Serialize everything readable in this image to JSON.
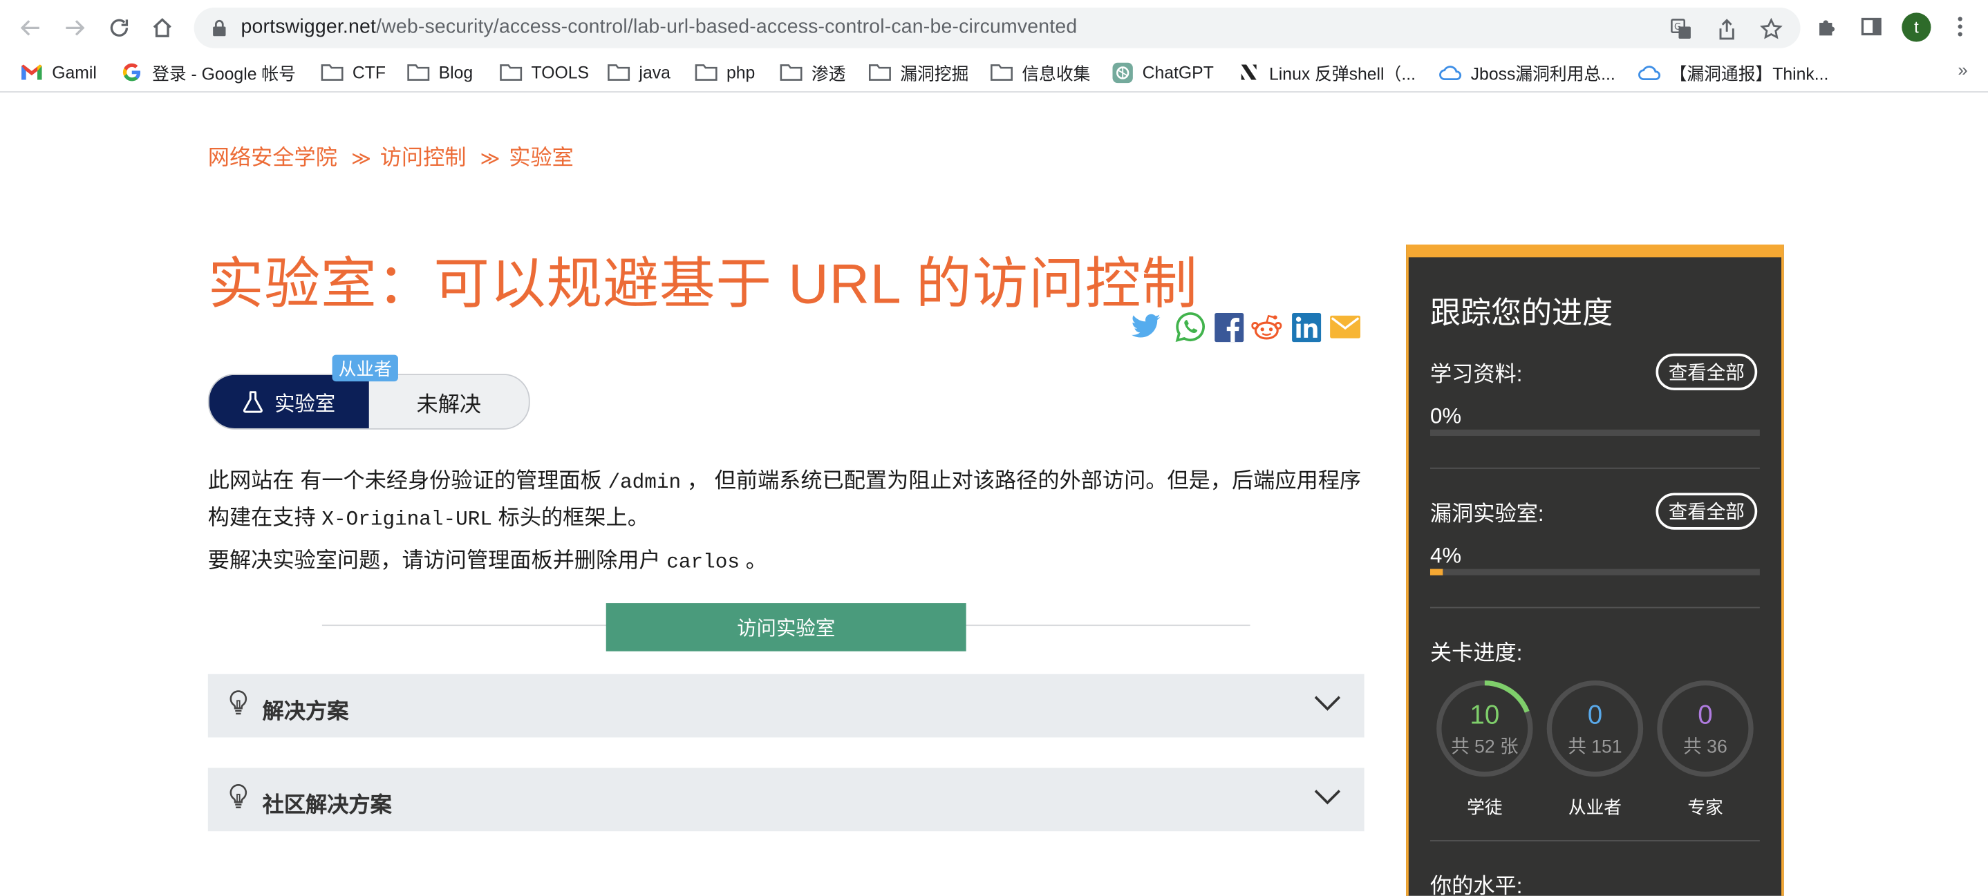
{
  "browser": {
    "url_host": "portswigger.net",
    "url_path": "/web-security/access-control/lab-url-based-access-control-can-be-circumvented",
    "profile_initial": "t",
    "bookmarks": [
      {
        "label": "Gamil",
        "icon": "gmail-icon"
      },
      {
        "label": "登录 - Google 帐号",
        "icon": "google-icon"
      },
      {
        "label": "CTF",
        "icon": "folder-icon"
      },
      {
        "label": "Blog",
        "icon": "folder-icon"
      },
      {
        "label": "TOOLS",
        "icon": "folder-icon"
      },
      {
        "label": "java",
        "icon": "folder-icon"
      },
      {
        "label": "php",
        "icon": "folder-icon"
      },
      {
        "label": "渗透",
        "icon": "folder-icon"
      },
      {
        "label": "漏洞挖掘",
        "icon": "folder-icon"
      },
      {
        "label": "信息收集",
        "icon": "folder-icon"
      },
      {
        "label": "ChatGPT",
        "icon": "chatgpt-icon"
      },
      {
        "label": "Linux 反弹shell（...",
        "icon": "notion-icon"
      },
      {
        "label": "Jboss漏洞利用总...",
        "icon": "cloud-icon"
      },
      {
        "label": "【漏洞通报】Think...",
        "icon": "cloud-icon"
      }
    ],
    "more_bookmarks": "»"
  },
  "breadcrumb": {
    "items": [
      "网络安全学院",
      "访问控制",
      "实验室"
    ],
    "separator": "≫"
  },
  "page": {
    "title": "实验室：可以规避基于 URL 的访问控制",
    "level_badge": "从业者",
    "lab_label": "实验室",
    "status": "未解决",
    "desc_part1": "此网站在 有一个未经身份验证的管理面板",
    "desc_code1": "/admin",
    "desc_part2": "， 但前端系统已配置为阻止对该路径的外部访问。但是，后端应用程序构建在支持",
    "desc_code2": "X-Original-URL",
    "desc_part3": "标头的框架上。",
    "task_part1": "要解决实验室问题，请访问管理面板并删除用户",
    "task_code": "carlos",
    "task_part2": "。",
    "access_button": "访问实验室",
    "solution_label": "解决方案",
    "community_label": "社区解决方案"
  },
  "sidebar": {
    "title": "跟踪您的进度",
    "learning_label": "学习资料:",
    "learning_pct": "0%",
    "learning_progress": 0,
    "labs_label": "漏洞实验室:",
    "labs_pct": "4%",
    "labs_progress": 0.04,
    "view_all": "查看全部",
    "levels_label": "关卡进度:",
    "rings": [
      {
        "count": "10",
        "total": "共 52 张",
        "label": "学徒",
        "color": "#7fcf6b",
        "fraction": 0.19
      },
      {
        "count": "0",
        "total": "共 151",
        "label": "从业者",
        "color": "#59a9ea",
        "fraction": 0
      },
      {
        "count": "0",
        "total": "共 36",
        "label": "专家",
        "color": "#b07ce0",
        "fraction": 0
      }
    ],
    "your_level": "你的水平:"
  },
  "colors": {
    "accent": "#ec6b36",
    "lab_navy": "#0c1f57",
    "access_green": "#4a9b7c",
    "sidebar_bg": "#333332",
    "sidebar_border": "#f5a833"
  }
}
